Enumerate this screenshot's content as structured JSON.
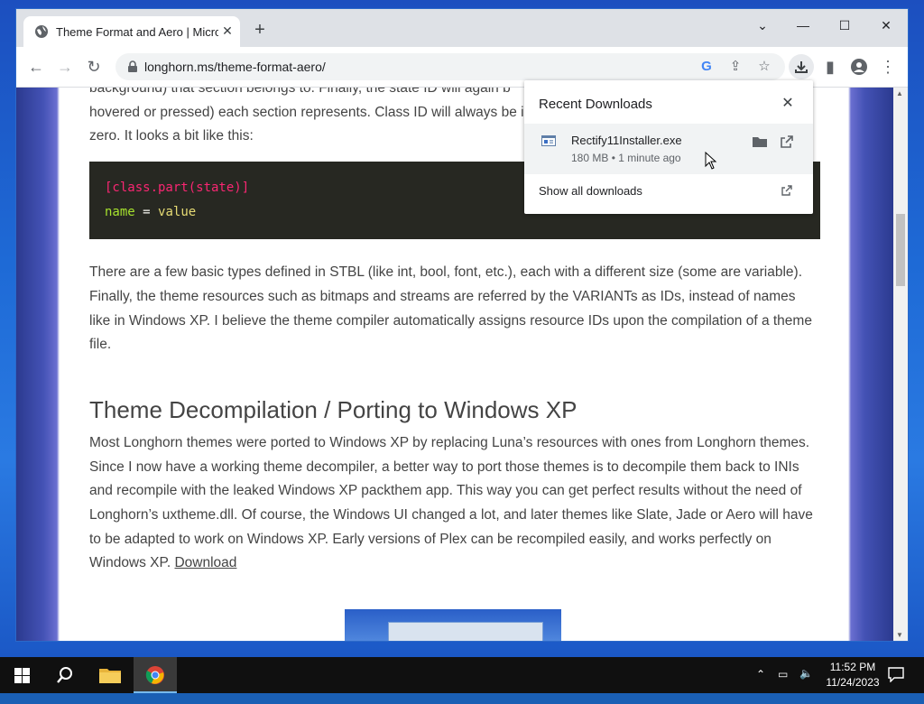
{
  "browser": {
    "tab_title": "Theme Format and Aero | Microsoft",
    "new_tab": "+",
    "url": "longhorn.ms/theme-format-aero/"
  },
  "article": {
    "para1": "background) that section belongs to. Finally, the state ID will again be hovered or pressed) each section represents. Class ID will always be in zero. It looks a bit like this:",
    "para1_line1": "background) that section belongs to. Finally, the state ID will again b",
    "para1_line2": "hovered or pressed) each section represents. Class ID will always be i",
    "para1_line3": "zero. It looks a bit like this:",
    "code_line1": "[class.part(state)]",
    "code_key": "name",
    "code_eq": "=",
    "code_val": "value",
    "para2": "There are a few basic types defined in STBL (like int, bool, font, etc.), each with a different size (some are variable). Finally, the theme resources such as bitmaps and streams are referred by the VARIANTs as IDs, instead of names like in Windows XP. I believe the theme compiler automatically assigns resource IDs upon the compilation of a theme file.",
    "heading": "Theme Decompilation / Porting to Windows XP",
    "para3": "Most Longhorn themes were ported to Windows XP by replacing Luna’s resources with ones from Longhorn themes. Since I now have a working theme decompiler, a better way to port those themes is to decompile them back to INIs and recompile with the leaked Windows XP packthem app. This way you can get perfect results without the need of Longhorn’s uxtheme.dll. Of course, the Windows UI changed a lot, and later themes like Slate, Jade or Aero will have to be adapted to work on Windows XP. Early versions of Plex can be recompiled easily, and works perfectly on Windows XP.",
    "download_link": "Download"
  },
  "downloads": {
    "title": "Recent Downloads",
    "file_name": "Rectify11Installer.exe",
    "file_meta": "180 MB • 1 minute ago",
    "show_all": "Show all downloads"
  },
  "taskbar": {
    "time": "11:52 PM",
    "date": "11/24/2023"
  },
  "colors": {
    "code_bg": "#272822",
    "code_pink": "#f92672",
    "code_green": "#a6e22e",
    "code_yellow": "#e6db74",
    "taskbar_bg": "#101010"
  }
}
